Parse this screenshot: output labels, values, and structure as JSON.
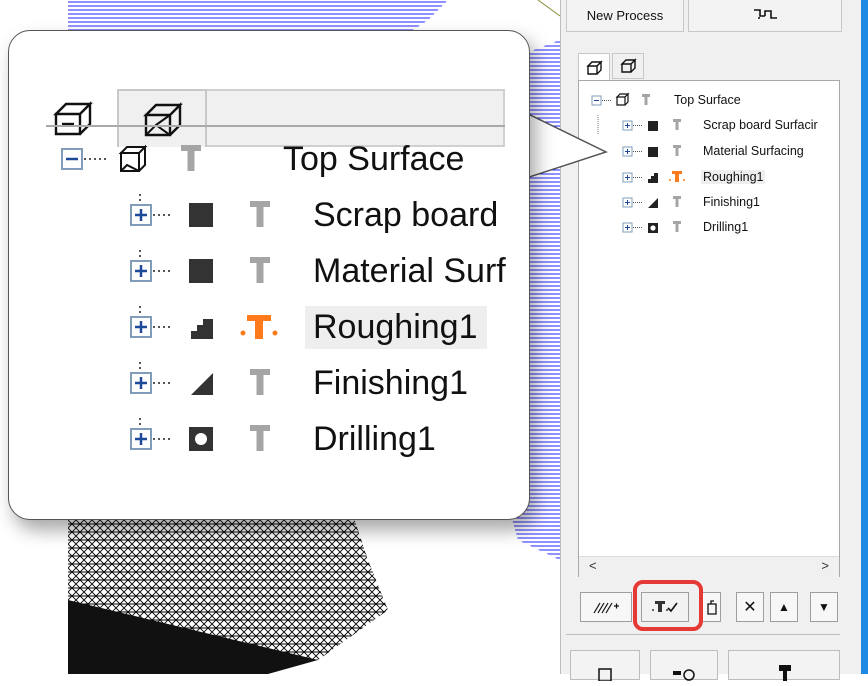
{
  "panel": {
    "new_process_label": "New Process",
    "tree": {
      "root_label": "Top Surface",
      "items": [
        {
          "label": "Scrap board Surfacir",
          "icon": "square-icon"
        },
        {
          "label": "Material Surfacing",
          "icon": "square-icon"
        },
        {
          "label": "Roughing1",
          "icon": "stairs-icon",
          "selected": true
        },
        {
          "label": "Finishing1",
          "icon": "slope-icon"
        },
        {
          "label": "Drilling1",
          "icon": "hole-icon"
        }
      ]
    },
    "scroll": {
      "left_arrow": "<",
      "right_arrow": ">"
    },
    "buttons": {
      "delete_label": "✕",
      "up_label": "▲",
      "down_label": "▼"
    }
  },
  "callout": {
    "root_label": "Top Surface",
    "items": [
      {
        "label": "Scrap board",
        "icon": "square-icon"
      },
      {
        "label": "Material Surf",
        "icon": "square-icon"
      },
      {
        "label": "Roughing1",
        "icon": "stairs-icon",
        "selected": true
      },
      {
        "label": "Finishing1",
        "icon": "slope-icon"
      },
      {
        "label": "Drilling1",
        "icon": "hole-icon"
      }
    ]
  },
  "colors": {
    "accent_orange": "#ff7a1a",
    "highlight_red": "#e53935",
    "tool_gray": "#a5a5a5",
    "toolpath_blue": "#1a1aff",
    "side_bar_blue": "#1e88e5"
  }
}
